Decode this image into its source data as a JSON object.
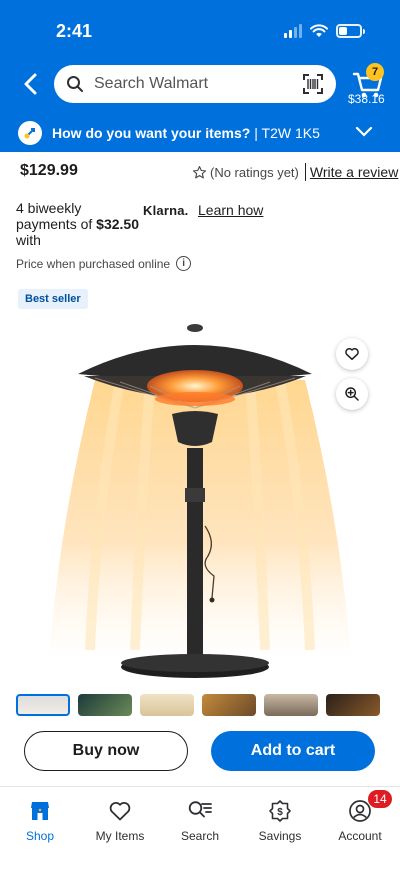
{
  "status": {
    "time": "2:41"
  },
  "header": {
    "search_placeholder": "Search Walmart",
    "cart_count": "7",
    "cart_total": "$38.16",
    "delivery_prompt": "How do you want your items?",
    "delivery_location": " | T2W 1K5"
  },
  "product": {
    "price": "$129.99",
    "rating_text": "(No ratings yet)",
    "write_review": "Write a review",
    "klarna_line1": "4 biweekly",
    "klarna_line2_prefix": "payments of ",
    "klarna_amount": "$32.50",
    "klarna_line3": "with",
    "klarna_logo": "Klarna.",
    "klarna_link": "Learn how",
    "price_note": "Price when purchased online",
    "badge": "Best seller"
  },
  "actions": {
    "buy_now": "Buy now",
    "add_to_cart": "Add to cart"
  },
  "nav": {
    "items": [
      {
        "label": "Shop",
        "icon": "shop-icon"
      },
      {
        "label": "My Items",
        "icon": "heart-icon"
      },
      {
        "label": "Search",
        "icon": "search-list-icon"
      },
      {
        "label": "Savings",
        "icon": "savings-tag-icon"
      },
      {
        "label": "Account",
        "icon": "account-icon"
      }
    ],
    "account_badge": "14"
  },
  "colors": {
    "brand_blue": "#0071dc",
    "spark_yellow": "#ffc220",
    "badge_red": "#de1c24"
  }
}
